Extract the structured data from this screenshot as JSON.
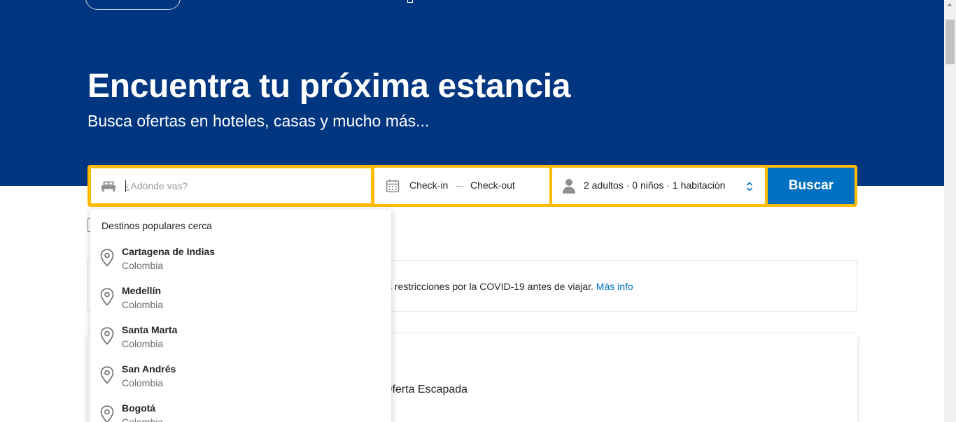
{
  "hero": {
    "title": "Encuentra tu próxima estancia",
    "subtitle": "Busca ofertas en hoteles, casas y mucho más..."
  },
  "search": {
    "destination_placeholder": "¿Adónde vas?",
    "destination_value": "",
    "checkin_label": "Check-in",
    "checkout_label": "Check-out",
    "guests": {
      "adults": "2 adultos",
      "separator": "·",
      "children": "0 niños",
      "rooms": "1 habitación"
    },
    "button_label": "Buscar"
  },
  "dropdown": {
    "heading": "Destinos populares cerca",
    "items": [
      {
        "city": "Cartagena de Indias",
        "country": "Colombia"
      },
      {
        "city": "Medellín",
        "country": "Colombia"
      },
      {
        "city": "Santa Marta",
        "country": "Colombia"
      },
      {
        "city": "San Andrés",
        "country": "Colombia"
      },
      {
        "city": "Bogotá",
        "country": "Colombia"
      }
    ]
  },
  "notice": {
    "text": "s restricciones por la COVID-19 antes de viajar.",
    "link": "Más info"
  },
  "card": {
    "text": "Oferta Escapada"
  },
  "colors": {
    "brand_blue": "#003580",
    "search_border": "#febb02",
    "button_blue": "#0071c2",
    "link_blue": "#0071c2"
  },
  "icons": {
    "destination": "bed-icon",
    "dates": "calendar-icon",
    "guests": "person-icon",
    "guests_toggle": "chevron-updown-icon",
    "suggestion": "map-pin-icon"
  }
}
